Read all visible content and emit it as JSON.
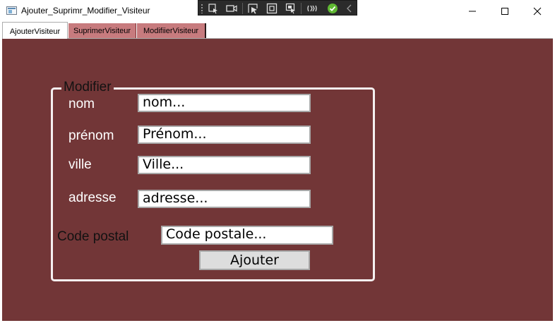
{
  "window": {
    "title": "Ajouter_Suprimr_Modifier_Visiteur",
    "icon": "app-window-icon"
  },
  "debug_toolbar": {
    "icons": [
      "grip-icon",
      "select-element-icon",
      "video-camera-icon",
      "pointer-select-icon",
      "display-layout-icon",
      "track-focus-icon",
      "hot-reload-icon",
      "checkmark-circle-icon",
      "collapse-chevron-icon"
    ]
  },
  "window_controls": [
    "minimize-icon",
    "maximize-icon",
    "close-icon"
  ],
  "tabs": [
    {
      "label": "AjouterVisiteur",
      "selected": true
    },
    {
      "label": "SuprimerVisiteur",
      "selected": false
    },
    {
      "label": "ModifiierVisiteur",
      "selected": false
    }
  ],
  "form": {
    "legend": "Modifier",
    "fields": [
      {
        "label": "nom",
        "placeholder": "nom..."
      },
      {
        "label": "prénom",
        "placeholder": "Prénom..."
      },
      {
        "label": "ville",
        "placeholder": "Ville..."
      },
      {
        "label": "adresse",
        "placeholder": "adresse..."
      },
      {
        "label": "Code postal",
        "placeholder": "Code postale..."
      }
    ],
    "submit_label": "Ajouter"
  },
  "colors": {
    "background": "#723637",
    "inactive_tab": "#c77b7e",
    "groupbox_border": "#f5f0f0",
    "debug_toolbar": "#2b2b2b",
    "hot_reload_check": "#5fb832"
  }
}
